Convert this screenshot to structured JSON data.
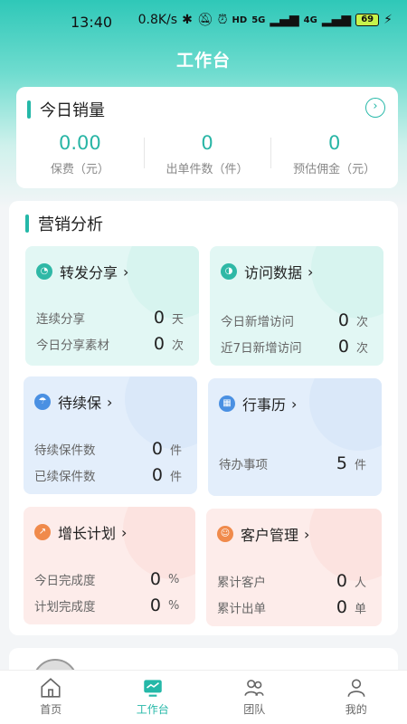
{
  "status_bar": {
    "time": "13:40",
    "net_speed": "0.8K/s",
    "hd": "HD",
    "sig1": "5G",
    "sig2": "4G",
    "battery": "69"
  },
  "header": {
    "title": "工作台"
  },
  "sales": {
    "title": "今日销量",
    "stats": [
      {
        "value": "0.00",
        "label": "保费（元）"
      },
      {
        "value": "0",
        "label": "出单件数（件）"
      },
      {
        "value": "0",
        "label": "预估佣金（元）"
      }
    ]
  },
  "analysis": {
    "title": "营销分析",
    "tiles": [
      {
        "title": "转发分享",
        "icon": "share-icon",
        "rows": [
          {
            "label": "连续分享",
            "value": "0",
            "unit": "天"
          },
          {
            "label": "今日分享素材",
            "value": "0",
            "unit": "次"
          }
        ]
      },
      {
        "title": "访问数据",
        "icon": "visit-chart-icon",
        "rows": [
          {
            "label": "今日新增访问",
            "value": "0",
            "unit": "次"
          },
          {
            "label": "近7日新增访问",
            "value": "0",
            "unit": "次"
          }
        ]
      },
      {
        "title": "待续保",
        "icon": "umbrella-icon",
        "rows": [
          {
            "label": "待续保件数",
            "value": "0",
            "unit": "件"
          },
          {
            "label": "已续保件数",
            "value": "0",
            "unit": "件"
          }
        ]
      },
      {
        "title": "行事历",
        "icon": "calendar-icon",
        "rows": [
          {
            "label": "待办事项",
            "value": "5",
            "unit": "件"
          }
        ]
      },
      {
        "title": "增长计划",
        "icon": "growth-chart-icon",
        "rows": [
          {
            "label": "今日完成度",
            "value": "0",
            "unit": "%"
          },
          {
            "label": "计划完成度",
            "value": "0",
            "unit": "%"
          }
        ]
      },
      {
        "title": "客户管理",
        "icon": "customer-icon",
        "rows": [
          {
            "label": "累计客户",
            "value": "0",
            "unit": "人"
          },
          {
            "label": "累计出单",
            "value": "0",
            "unit": "单"
          }
        ]
      }
    ]
  },
  "tabbar": [
    {
      "label": "首页",
      "icon": "home-icon"
    },
    {
      "label": "工作台",
      "icon": "workbench-icon"
    },
    {
      "label": "团队",
      "icon": "team-icon"
    },
    {
      "label": "我的",
      "icon": "profile-icon"
    }
  ],
  "colors": {
    "accent": "#25b8a8",
    "header": "#2fc8b8"
  }
}
